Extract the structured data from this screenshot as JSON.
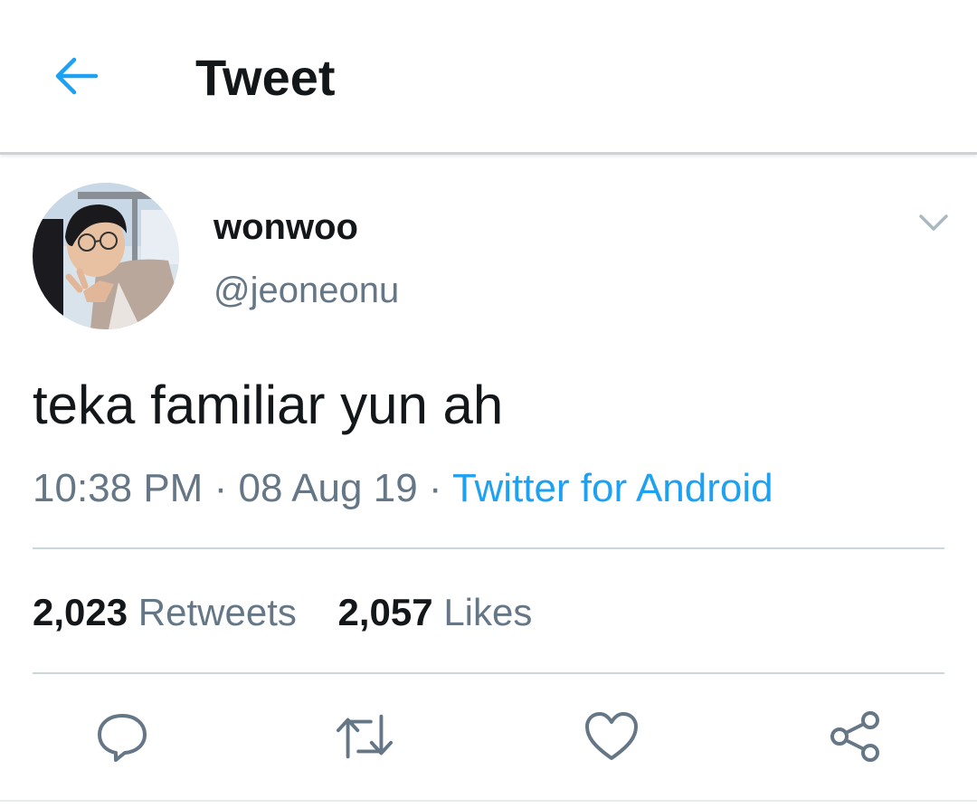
{
  "header": {
    "title": "Tweet",
    "back_icon": "arrow-left-icon",
    "accent": "#1da1f2"
  },
  "tweet": {
    "author": {
      "display_name": "wonwoo",
      "handle": "@jeoneonu"
    },
    "menu_icon": "chevron-down-icon",
    "text": "teka familiar yun ah",
    "time": "10:38 PM",
    "separator": "·",
    "date": "08 Aug 19",
    "source": "Twitter for Android",
    "stats": {
      "retweets_count": "2,023",
      "retweets_label": "Retweets",
      "likes_count": "2,057",
      "likes_label": "Likes"
    },
    "actions": [
      {
        "icon": "reply-icon"
      },
      {
        "icon": "retweet-icon"
      },
      {
        "icon": "like-icon"
      },
      {
        "icon": "share-icon"
      }
    ]
  },
  "colors": {
    "text_primary": "#14171a",
    "text_secondary": "#657786",
    "link": "#1da1f2",
    "divider": "#ccd6dd"
  }
}
